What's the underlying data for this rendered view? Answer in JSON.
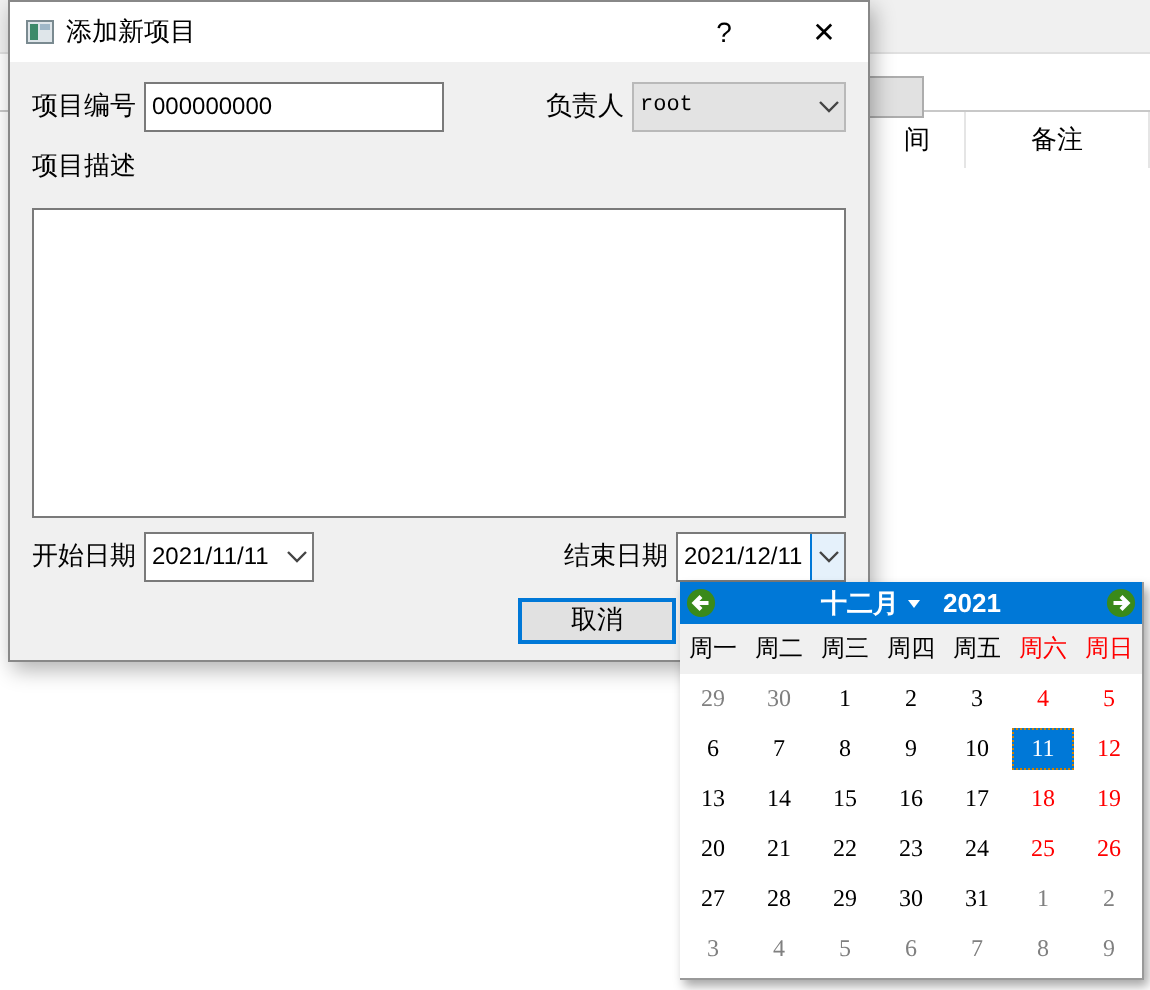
{
  "background_window": {
    "columns": [
      "间",
      "备注"
    ]
  },
  "dialog": {
    "title": "添加新项目",
    "help": "?",
    "close": "✕",
    "project_number": {
      "label": "项目编号",
      "value": "000000000"
    },
    "owner": {
      "label": "负责人",
      "value": "root",
      "disabled": true
    },
    "description": {
      "label": "项目描述"
    },
    "start_date": {
      "label": "开始日期",
      "value": "2021/11/11"
    },
    "end_date": {
      "label": "结束日期",
      "value": "2021/12/11",
      "expanded": true
    },
    "cancel": "取消"
  },
  "calendar": {
    "month": "十二月",
    "year": "2021",
    "weekdays": [
      {
        "label": "周一",
        "weekend": false
      },
      {
        "label": "周二",
        "weekend": false
      },
      {
        "label": "周三",
        "weekend": false
      },
      {
        "label": "周四",
        "weekend": false
      },
      {
        "label": "周五",
        "weekend": false
      },
      {
        "label": "周六",
        "weekend": true
      },
      {
        "label": "周日",
        "weekend": true
      }
    ],
    "weeks": [
      [
        {
          "day": "29",
          "other": true,
          "selected": false
        },
        {
          "day": "30",
          "other": true,
          "selected": false
        },
        {
          "day": "1",
          "other": false,
          "selected": false
        },
        {
          "day": "2",
          "other": false,
          "selected": false
        },
        {
          "day": "3",
          "other": false,
          "selected": false
        },
        {
          "day": "4",
          "other": false,
          "selected": false
        },
        {
          "day": "5",
          "other": false,
          "selected": false
        }
      ],
      [
        {
          "day": "6",
          "other": false,
          "selected": false
        },
        {
          "day": "7",
          "other": false,
          "selected": false
        },
        {
          "day": "8",
          "other": false,
          "selected": false
        },
        {
          "day": "9",
          "other": false,
          "selected": false
        },
        {
          "day": "10",
          "other": false,
          "selected": false
        },
        {
          "day": "11",
          "other": false,
          "selected": true
        },
        {
          "day": "12",
          "other": false,
          "selected": false
        }
      ],
      [
        {
          "day": "13",
          "other": false,
          "selected": false
        },
        {
          "day": "14",
          "other": false,
          "selected": false
        },
        {
          "day": "15",
          "other": false,
          "selected": false
        },
        {
          "day": "16",
          "other": false,
          "selected": false
        },
        {
          "day": "17",
          "other": false,
          "selected": false
        },
        {
          "day": "18",
          "other": false,
          "selected": false
        },
        {
          "day": "19",
          "other": false,
          "selected": false
        }
      ],
      [
        {
          "day": "20",
          "other": false,
          "selected": false
        },
        {
          "day": "21",
          "other": false,
          "selected": false
        },
        {
          "day": "22",
          "other": false,
          "selected": false
        },
        {
          "day": "23",
          "other": false,
          "selected": false
        },
        {
          "day": "24",
          "other": false,
          "selected": false
        },
        {
          "day": "25",
          "other": false,
          "selected": false
        },
        {
          "day": "26",
          "other": false,
          "selected": false
        }
      ],
      [
        {
          "day": "27",
          "other": false,
          "selected": false
        },
        {
          "day": "28",
          "other": false,
          "selected": false
        },
        {
          "day": "29",
          "other": false,
          "selected": false
        },
        {
          "day": "30",
          "other": false,
          "selected": false
        },
        {
          "day": "31",
          "other": false,
          "selected": false
        },
        {
          "day": "1",
          "other": true,
          "selected": false
        },
        {
          "day": "2",
          "other": true,
          "selected": false
        }
      ],
      [
        {
          "day": "3",
          "other": true,
          "selected": false
        },
        {
          "day": "4",
          "other": true,
          "selected": false
        },
        {
          "day": "5",
          "other": true,
          "selected": false
        },
        {
          "day": "6",
          "other": true,
          "selected": false
        },
        {
          "day": "7",
          "other": true,
          "selected": false
        },
        {
          "day": "8",
          "other": true,
          "selected": false
        },
        {
          "day": "9",
          "other": true,
          "selected": false
        }
      ]
    ]
  }
}
